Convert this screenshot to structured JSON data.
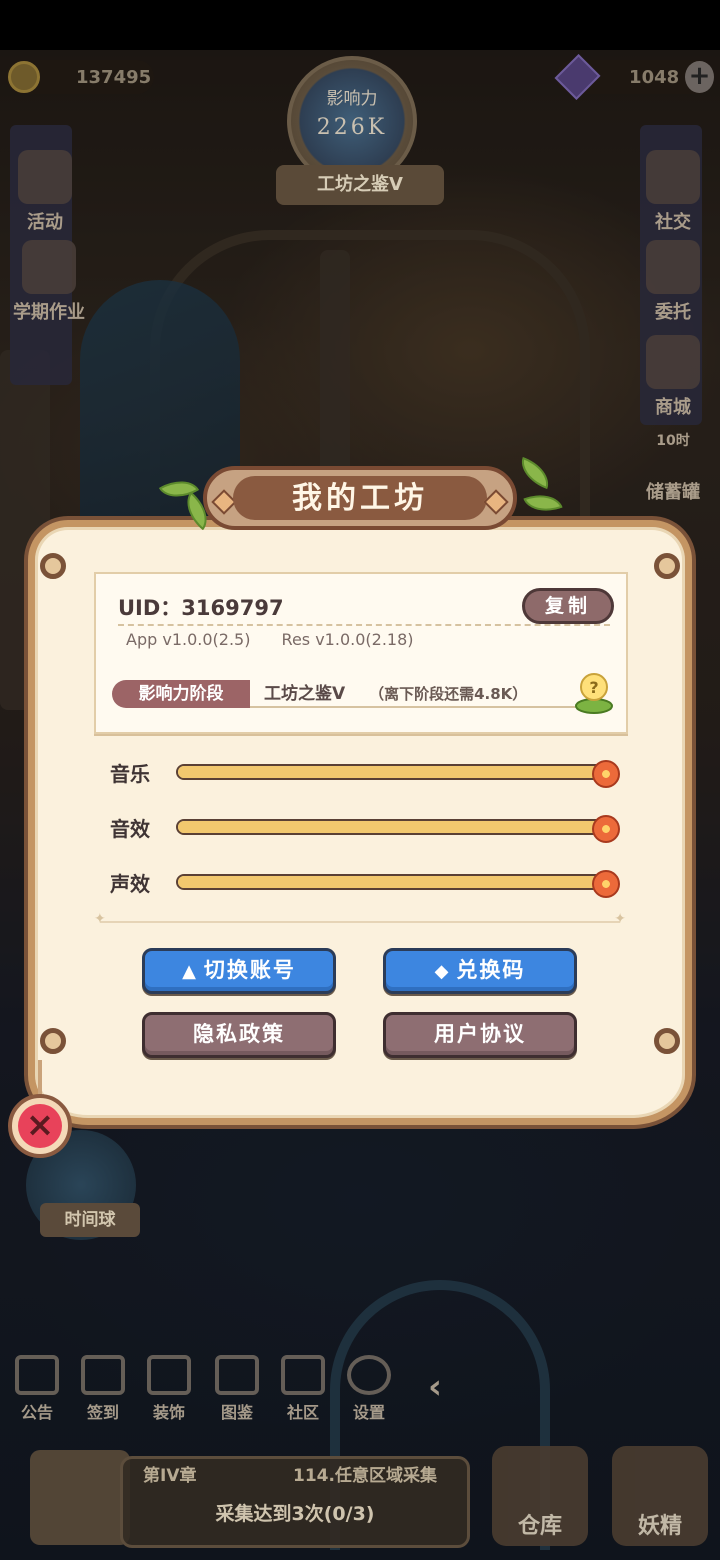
{
  "hud": {
    "coins": "137495",
    "gems": "1048",
    "influence_label": "影响力",
    "influence_value": "226K",
    "rank_title": "工坊之鉴V"
  },
  "left_menu": [
    {
      "label": "活动"
    },
    {
      "label": "学期作业"
    }
  ],
  "right_menu": [
    {
      "label": "社交"
    },
    {
      "label": "委托"
    },
    {
      "label": "商城"
    },
    {
      "label": "储蓄罐",
      "timer": "10时"
    }
  ],
  "dialog": {
    "title": "我的工坊",
    "uid_text": "UID：3169797",
    "copy_label": "复制",
    "app_version": "App v1.0.0(2.5)",
    "res_version": "Res v1.0.0(2.18)",
    "stage_label": "影响力阶段",
    "stage_value": "工坊之鉴V",
    "stage_hint": "（离下阶段还需4.8K）",
    "sliders": [
      {
        "label": "音乐",
        "value": 1.0
      },
      {
        "label": "音效",
        "value": 1.0
      },
      {
        "label": "声效",
        "value": 1.0
      }
    ],
    "buttons": {
      "switch_account": "切换账号",
      "redeem_code": "兑换码",
      "privacy_policy": "隐私政策",
      "user_agreement": "用户协议"
    }
  },
  "time_ball_label": "时间球",
  "bottom_nav": [
    {
      "label": "公告"
    },
    {
      "label": "签到"
    },
    {
      "label": "装饰"
    },
    {
      "label": "图鉴"
    },
    {
      "label": "社区"
    },
    {
      "label": "设置"
    }
  ],
  "quest": {
    "chapter": "第IV章",
    "task": "114.任意区域采集",
    "progress": "采集达到3次(0/3)"
  },
  "warehouse_label": "仓库",
  "fairy_label": "妖精",
  "colors": {
    "dialog_bg": "#fbf1dd",
    "dialog_border": "#c49563",
    "blue_button": "#3d86e0",
    "mauve_button": "#8e6e72",
    "close_red": "#e8425a"
  }
}
